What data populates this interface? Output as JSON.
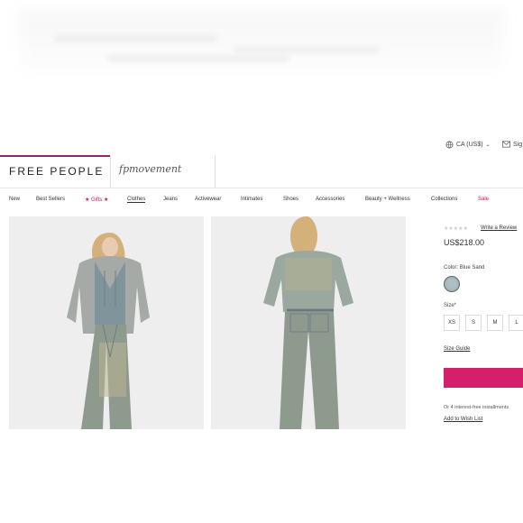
{
  "header": {
    "locale": "CA (US$)",
    "signin_label": "Sig",
    "logo": "FREE PEOPLE",
    "sub_brand": "fpmovement"
  },
  "nav": {
    "items": [
      "New",
      "Best Sellers",
      "★ Gifts ★",
      "Clothes",
      "Jeans",
      "Activewear",
      "Intimates",
      "Shoes",
      "Accessories",
      "Beauty + Wellness",
      "Collections",
      "Sale"
    ]
  },
  "product": {
    "stars": "★★★★★",
    "review_link": "Write a Review",
    "price": "US$218.00",
    "color_label": "Color: Blue Sand",
    "size_label": "Size*",
    "sizes": [
      "XS",
      "S",
      "M",
      "L"
    ],
    "size_guide": "Size Guide",
    "installments": "Or 4 interest-free installments",
    "wishlist": "Add to Wish List"
  },
  "colors": {
    "brand": "#8a2a6f",
    "cta": "#d61f6b",
    "sale": "#d0104f"
  }
}
